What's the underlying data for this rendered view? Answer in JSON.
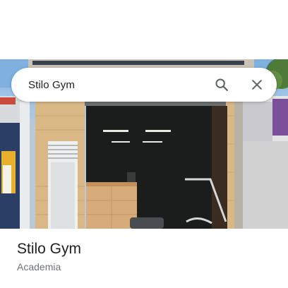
{
  "search": {
    "query": "Stilo Gym"
  },
  "icons": {
    "search": "search-icon",
    "close": "close-icon"
  },
  "place": {
    "name": "Stilo Gym",
    "category": "Academia"
  },
  "colors": {
    "title_text": "#202124",
    "secondary_text": "#70757a",
    "icon": "#5f6368"
  }
}
